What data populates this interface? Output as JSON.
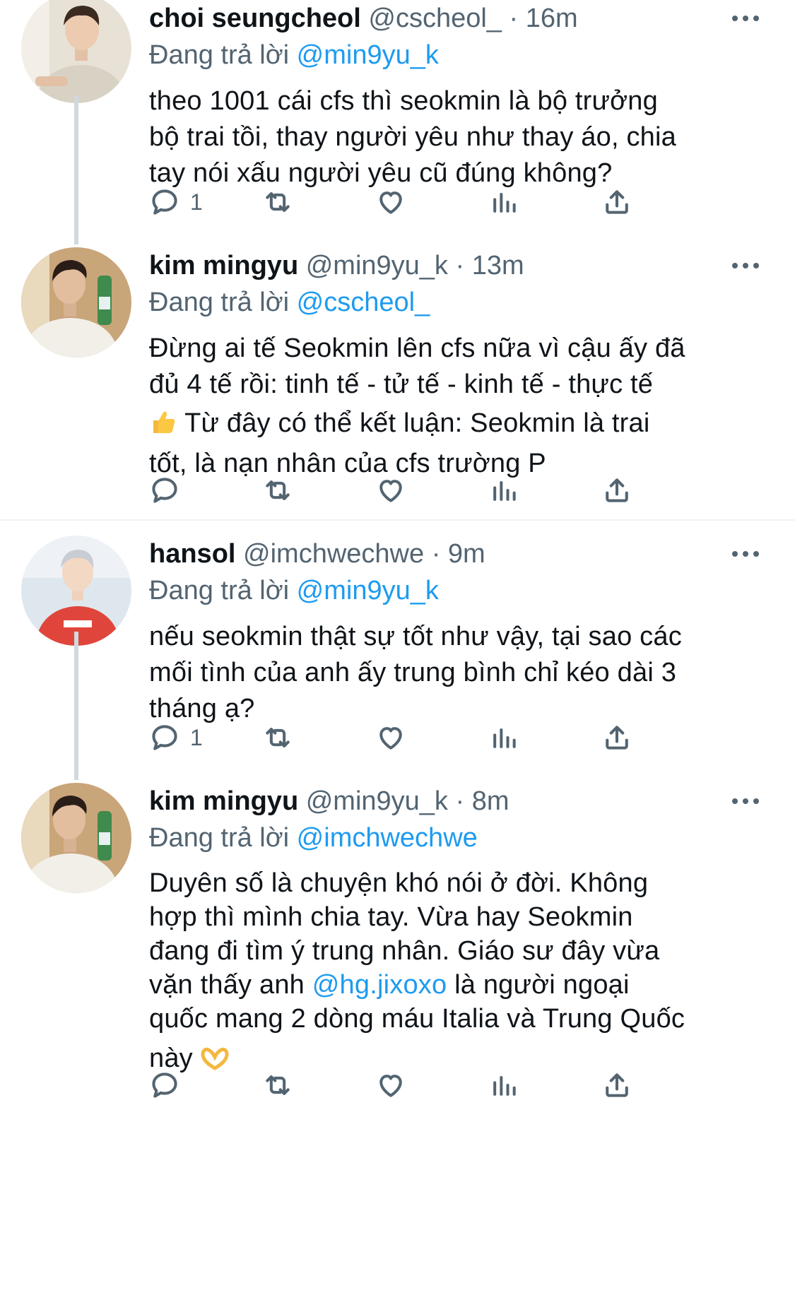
{
  "tweets": [
    {
      "name": "choi seungcheol",
      "handle": "@cscheol_",
      "dot": "·",
      "time": "16m",
      "replying_prefix": "Đang trả lời",
      "replying_to": "@min9yu_k",
      "lines": [
        "theo 1001 cái cfs thì seokmin là bộ trưởng",
        "bộ trai tồi, thay người yêu như thay áo, chia",
        "tay nói xấu người yêu cũ đúng không?"
      ],
      "reply_count": "1"
    },
    {
      "name": "kim mingyu",
      "handle": "@min9yu_k",
      "dot": "·",
      "time": "13m",
      "replying_prefix": "Đang trả lời",
      "replying_to": "@cscheol_",
      "lines": [
        "Đừng ai tế Seokmin lên cfs nữa vì cậu ấy đã",
        "đủ 4 tế rồi: tinh tế - tử tế - kinh tế - thực tế",
        " Từ đây có thể kết luận: Seokmin là trai",
        "tốt, là nạn nhân của cfs trường P"
      ],
      "emoji": "thumbs-up",
      "reply_count": ""
    },
    {
      "name": "hansol",
      "handle": "@imchwechwe",
      "dot": "·",
      "time": "9m",
      "replying_prefix": "Đang trả lời",
      "replying_to": "@min9yu_k",
      "lines": [
        "nếu seokmin thật sự tốt như vậy, tại sao các",
        "mối tình của anh ấy trung bình chỉ kéo dài 3",
        "tháng ạ?"
      ],
      "reply_count": "1"
    },
    {
      "name": "kim mingyu",
      "handle": "@min9yu_k",
      "dot": "·",
      "time": "8m",
      "replying_prefix": "Đang trả lời",
      "replying_to": "@imchwechwe",
      "lines": [
        "Duyên số là chuyện khó nói ở đời. Không",
        "hợp thì mình chia tay. Vừa hay Seokmin",
        "đang đi tìm ý trung nhân. Giáo sư đây vừa",
        "vặn thấy anh ",
        "@hg.jixoxo",
        " là người ngoại",
        "quốc mang 2 dòng máu Italia và Trung Quốc",
        "này "
      ],
      "emoji": "heart-hands",
      "reply_count": ""
    }
  ],
  "icons": {
    "reply": "reply-icon",
    "retweet": "retweet-icon",
    "like": "heart-icon",
    "analytics": "analytics-icon",
    "share": "share-icon",
    "more": "more-icon"
  },
  "colors": {
    "mention": "#1d9bf0",
    "secondary_text": "#536471",
    "thread_line": "#cfd9de"
  }
}
